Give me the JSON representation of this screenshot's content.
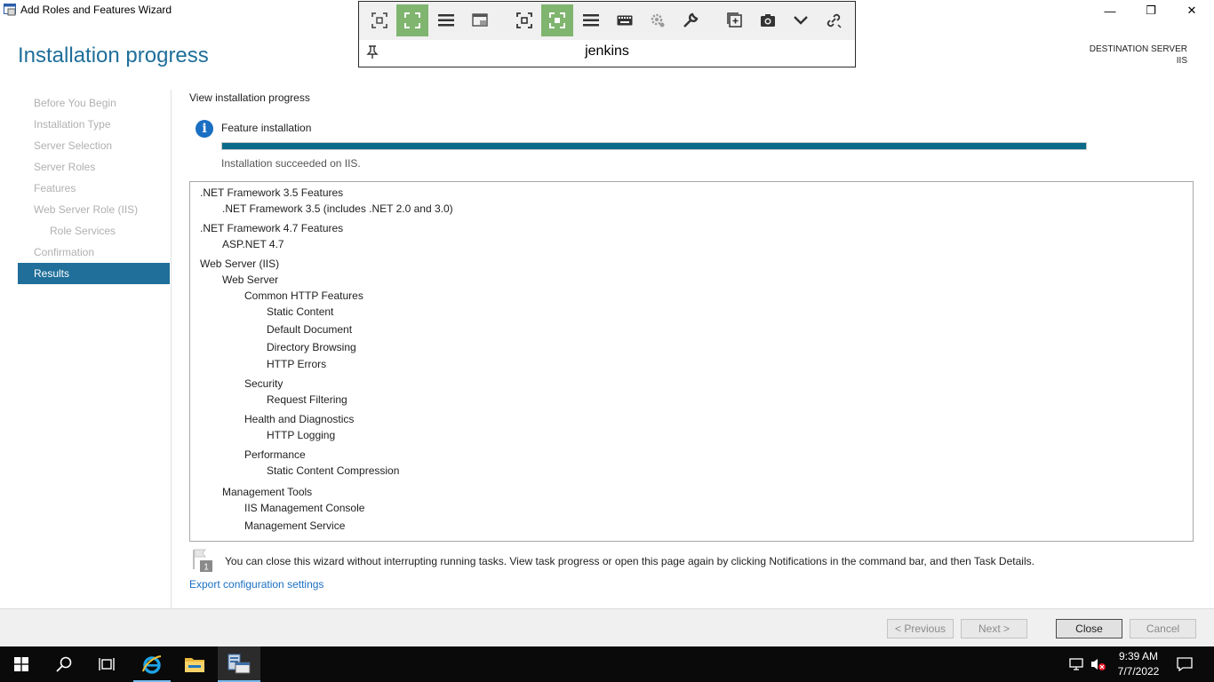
{
  "window": {
    "title": "Add Roles and Features Wizard",
    "minimize_glyph": "—",
    "maximize_glyph": "❐",
    "close_glyph": "✕"
  },
  "remote_toolbar": {
    "hostname": "jenkins",
    "icons": [
      "fit-window-icon",
      "fullscreen-icon",
      "menu-icon",
      "window-mode-icon",
      "fit-screen-icon",
      "fullscreen-active-icon",
      "menu-icon",
      "keyboard-icon",
      "settings-icon",
      "wrench-icon",
      "new-window-icon",
      "camera-icon",
      "chevron-down-icon",
      "disconnect-icon"
    ],
    "active_color": "#7fb56f"
  },
  "header": {
    "page_title": "Installation progress",
    "destination_label": "DESTINATION SERVER",
    "destination_value": "IIS"
  },
  "nav": {
    "items": [
      {
        "label": "Before You Begin",
        "state": "disabled"
      },
      {
        "label": "Installation Type",
        "state": "disabled"
      },
      {
        "label": "Server Selection",
        "state": "disabled"
      },
      {
        "label": "Server Roles",
        "state": "disabled"
      },
      {
        "label": "Features",
        "state": "disabled"
      },
      {
        "label": "Web Server Role (IIS)",
        "state": "disabled"
      },
      {
        "label": "Role Services",
        "state": "disabled"
      },
      {
        "label": "Confirmation",
        "state": "disabled"
      },
      {
        "label": "Results",
        "state": "active"
      }
    ]
  },
  "content": {
    "view_title": "View installation progress",
    "feature_installation": "Feature installation",
    "progress_fraction": 1.0,
    "progress_color": "#0b6a8a",
    "status": "Installation succeeded on IIS.",
    "results_tree": [
      ".NET Framework 3.5 Features",
      ".NET Framework 3.5 (includes .NET 2.0 and 3.0)",
      ".NET Framework 4.7 Features",
      "ASP.NET 4.7",
      "Web Server (IIS)",
      "Web Server",
      "Common HTTP Features",
      "Static Content",
      "Default Document",
      "Directory Browsing",
      "HTTP Errors",
      "Security",
      "Request Filtering",
      "Health and Diagnostics",
      "HTTP Logging",
      "Performance",
      "Static Content Compression",
      "Management Tools",
      "IIS Management Console",
      "Management Service"
    ],
    "footnote": "You can close this wizard without interrupting running tasks. View task progress or open this page again by clicking Notifications in the command bar, and then Task Details.",
    "flag_badge": "1",
    "export_link": "Export configuration settings"
  },
  "buttons": {
    "previous": "< Previous",
    "next": "Next >",
    "close": "Close",
    "cancel": "Cancel"
  },
  "taskbar": {
    "time": "9:39 AM",
    "date": "7/7/2022",
    "items": [
      "start-icon",
      "search-icon",
      "task-view-icon",
      "internet-explorer-icon",
      "file-explorer-icon",
      "server-manager-icon"
    ]
  }
}
